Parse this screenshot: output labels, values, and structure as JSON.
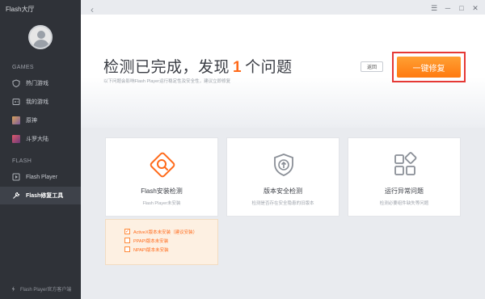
{
  "app": {
    "title": "Flash大厅"
  },
  "sidebar": {
    "sections": [
      {
        "label": "GAMES",
        "items": [
          {
            "label": "热门游戏",
            "icon": "shield-icon"
          },
          {
            "label": "我的游戏",
            "icon": "gamepad-icon"
          },
          {
            "label": "原神",
            "icon": "game-thumbnail-icon"
          },
          {
            "label": "斗罗大陆",
            "icon": "game-thumbnail-icon"
          }
        ]
      },
      {
        "label": "FLASH",
        "items": [
          {
            "label": "Flash Player",
            "icon": "play-icon"
          },
          {
            "label": "Flash修复工具",
            "icon": "wrench-icon",
            "active": true
          }
        ]
      }
    ],
    "footer": "Flash Player官方客户端"
  },
  "header": {
    "headline_prefix": "检测已完成，发现",
    "issue_count": "1",
    "headline_suffix": "个问题",
    "subline": "以下问题会影响Flash Player运行稳定性及安全性，建议立即修复",
    "return_label": "返回",
    "fix_label": "一键修复"
  },
  "cards": [
    {
      "title": "Flash安装检测",
      "desc": "Flash Player未安装",
      "icon": "magnifier-icon"
    },
    {
      "title": "版本安全检测",
      "desc": "检测是否存在安全隐患的旧版本",
      "icon": "shield-upload-icon"
    },
    {
      "title": "运行异常问题",
      "desc": "检测必要组件缺失等问题",
      "icon": "grid-icon"
    }
  ],
  "issues": [
    {
      "label": "ActiveX版本未安装（建议安装）",
      "checked": true
    },
    {
      "label": "PPAPI版本未安装",
      "checked": false
    },
    {
      "label": "NPAPI版本未安装",
      "checked": false
    }
  ],
  "colors": {
    "accent": "#ff7a10",
    "sidebar": "#2f3238",
    "highlight_border": "#e53935"
  }
}
